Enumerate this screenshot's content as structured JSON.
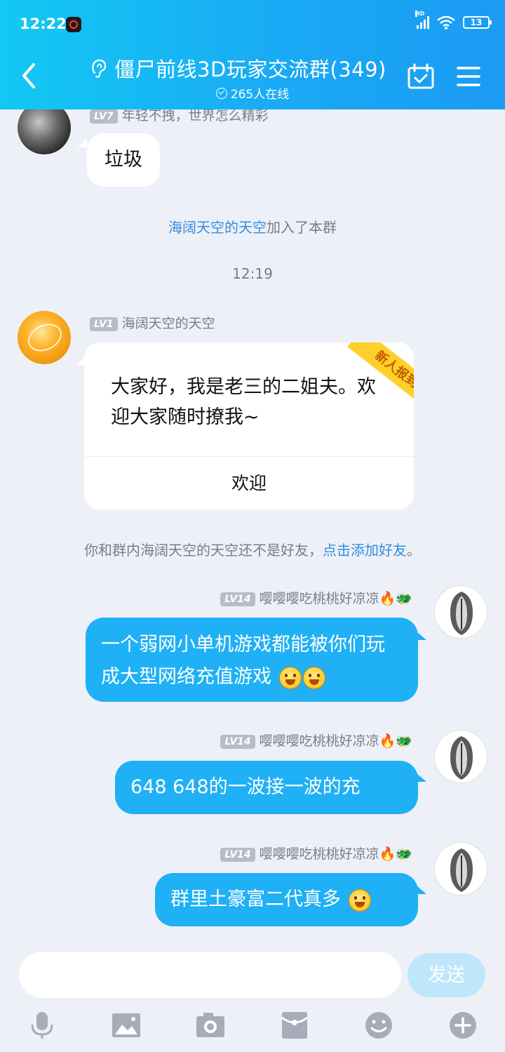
{
  "status_bar": {
    "time": "12:22",
    "network": "HD",
    "battery": "13"
  },
  "header": {
    "title": "僵尸前线3D玩家交流群(349)",
    "online": "265人在线"
  },
  "messages": {
    "m1": {
      "level": "LV7",
      "sender": "年轻不拽，世界怎么精彩",
      "text": "垃圾"
    },
    "join_notice": {
      "name": "海阔天空的天空",
      "suffix": "加入了本群"
    },
    "time_divider": "12:19",
    "m2": {
      "level": "LV1",
      "sender": "海阔天空的天空",
      "card_text": "大家好，我是老三的二姐夫。欢迎大家随时撩我~",
      "ribbon": "新人报到",
      "card_button": "欢迎"
    },
    "friend_notice": {
      "prefix": "你和群内海阔天空的天空还不是好友，",
      "link": "点击添加好友",
      "suffix": "。"
    },
    "m3": {
      "level": "LV14",
      "sender": "嘤嘤嘤吃桃桃好凉凉",
      "text": "一个弱网小单机游戏都能被你们玩成大型网络充值游戏"
    },
    "m4": {
      "level": "LV14",
      "sender": "嘤嘤嘤吃桃桃好凉凉",
      "text": "648 648的一波接一波的充"
    },
    "m5": {
      "level": "LV14",
      "sender": "嘤嘤嘤吃桃桃好凉凉",
      "text": "群里土豪富二代真多"
    }
  },
  "input_bar": {
    "placeholder": "",
    "send_label": "发送",
    "tools": [
      "microphone-icon",
      "image-icon",
      "camera-icon",
      "red-packet-icon",
      "emoji-icon",
      "plus-icon"
    ]
  },
  "colors": {
    "header_gradient": [
      "#13c8f3",
      "#1b9bf3"
    ],
    "outgoing_bubble": "#1fb0f5",
    "background": "#eef0f7",
    "link": "#2f8fe0",
    "send_button_disabled": "#bfe7fb"
  }
}
